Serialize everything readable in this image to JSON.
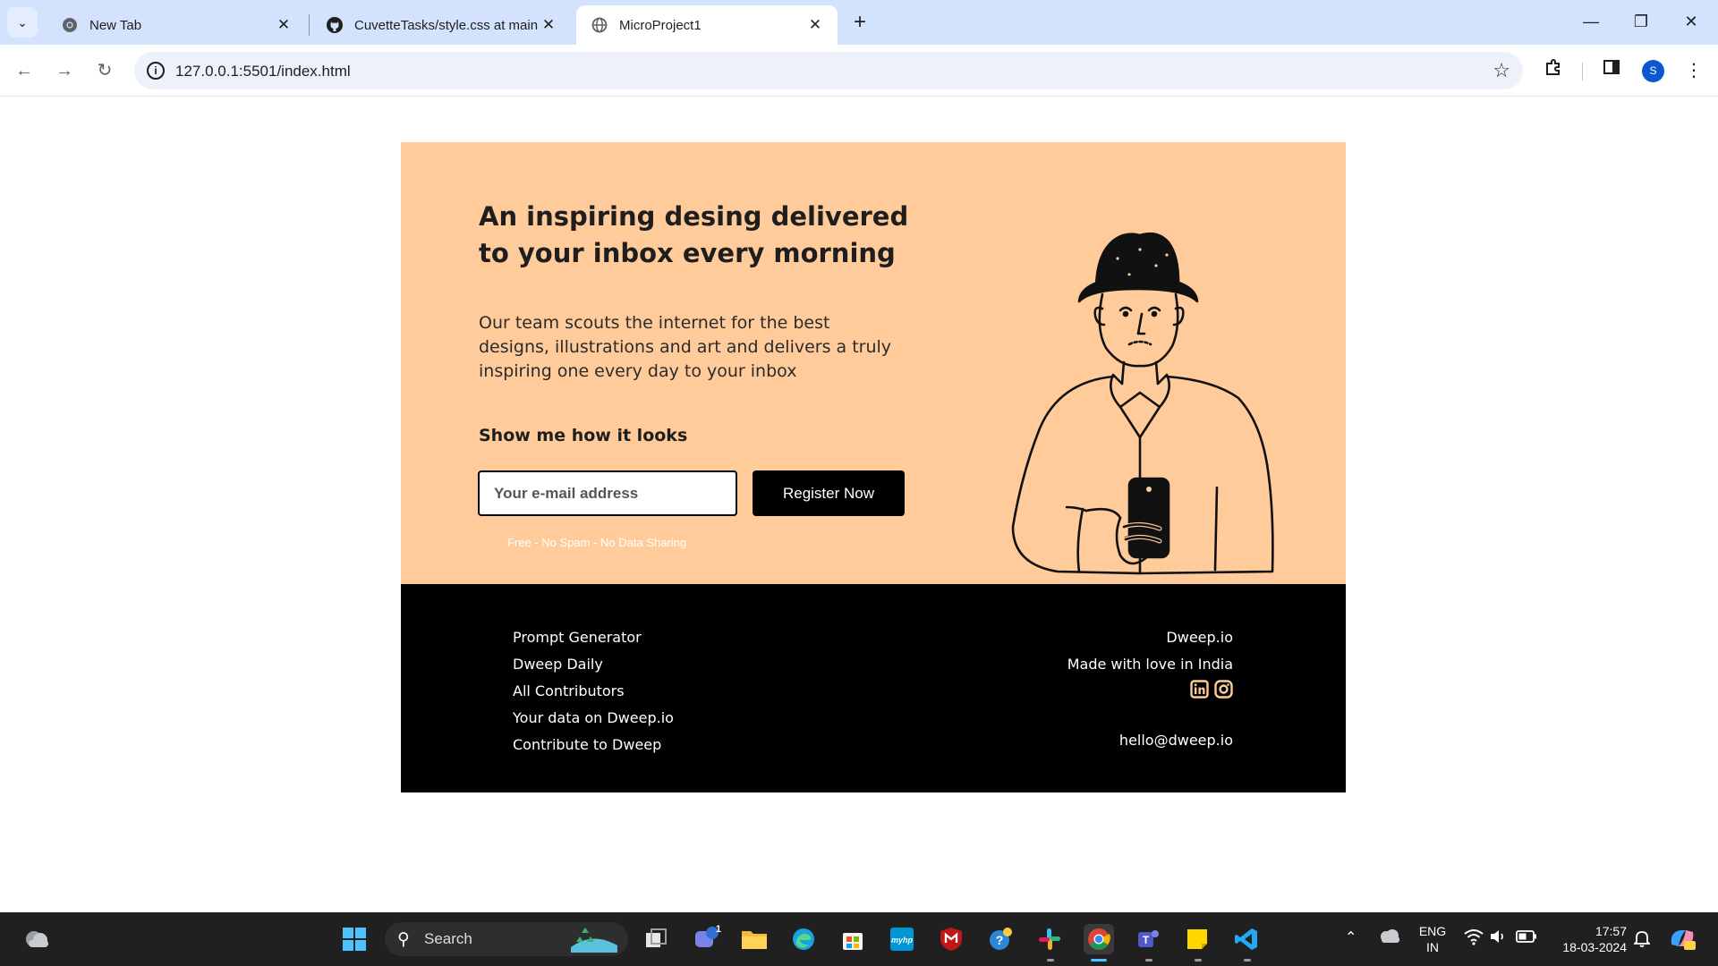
{
  "browser": {
    "tabs": [
      {
        "title": "New Tab",
        "favicon": "chrome-icon"
      },
      {
        "title": "CuvetteTasks/style.css at main · ",
        "favicon": "github-icon"
      },
      {
        "title": "MicroProject1",
        "favicon": "globe-icon",
        "active": true
      }
    ],
    "url": "127.0.0.1:5501/index.html",
    "profile_initial": "S"
  },
  "hero": {
    "title": "An inspiring desing delivered to your inbox every morning",
    "description": "Our team scouts the internet for the best designs, illustrations and art and delivers a truly inspiring one every day to your inbox",
    "subheading": "Show me how it looks",
    "email_placeholder": "Your e-mail address",
    "register_label": "Register Now",
    "note": "Free - No Spam - No Data Sharing",
    "background_color": "#ffcb9a"
  },
  "footer": {
    "links": [
      "Prompt Generator",
      "Dweep Daily",
      "All Contributors",
      "Your data on Dweep.io",
      "Contribute to Dweep"
    ],
    "brand": "Dweep.io",
    "tagline": "Made with love in India",
    "email": "hello@dweep.io",
    "socials": [
      "linkedin-icon",
      "instagram-icon"
    ]
  },
  "taskbar": {
    "search_label": "Search",
    "teams_badge": "1",
    "language_top": "ENG",
    "language_bottom": "IN",
    "time": "17:57",
    "date": "18-03-2024"
  }
}
